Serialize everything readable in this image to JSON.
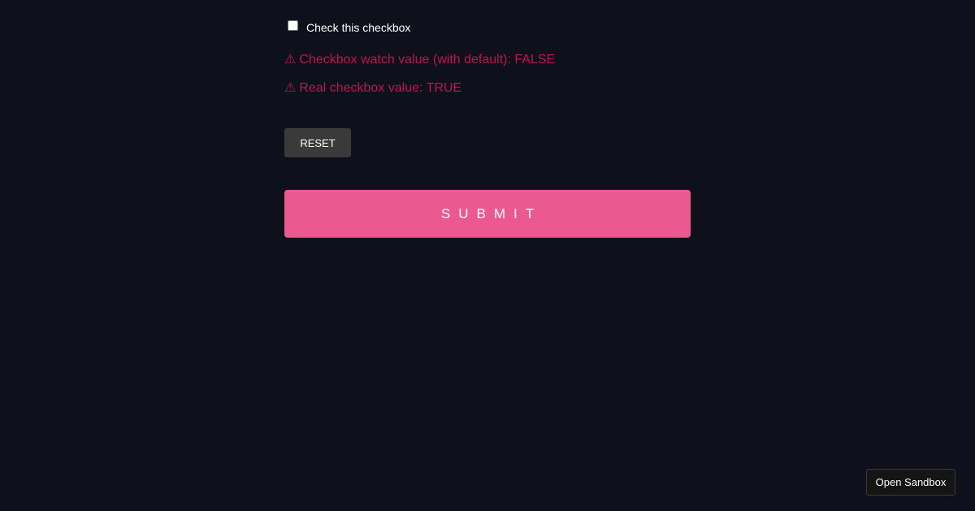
{
  "form": {
    "checkbox": {
      "label": "Check this checkbox",
      "checked": false
    },
    "warnings": [
      {
        "icon": "⚠",
        "text": "Checkbox watch value (with default): FALSE"
      },
      {
        "icon": "⚠",
        "text": "Real checkbox value: TRUE"
      }
    ],
    "reset_label": "RESET",
    "submit_label": "SUBMIT"
  },
  "sandbox": {
    "label": "Open Sandbox"
  },
  "colors": {
    "background": "#0e101c",
    "warning": "#bf1650",
    "submit": "#ec5990",
    "reset": "#3a3a3a"
  }
}
